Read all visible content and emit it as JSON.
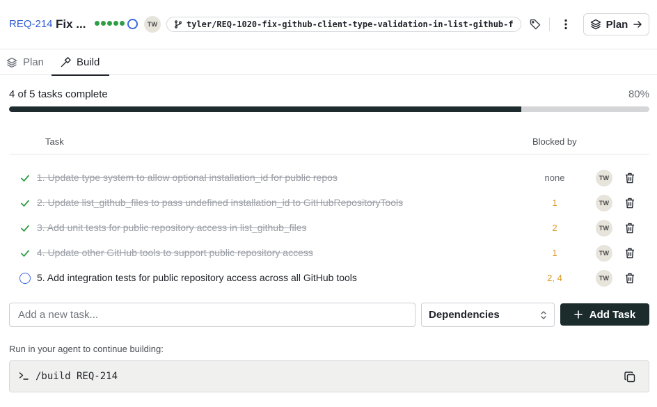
{
  "header": {
    "req_id": "REQ-214",
    "title": "Fix ...",
    "assignee_initials": "TW",
    "branch": "tyler/REQ-1020-fix-github-client-type-validation-in-list-github-f",
    "plan_button_label": "Plan",
    "accent_color": "#2f5bd3"
  },
  "tabs": [
    {
      "label": "Plan",
      "icon": "layers-icon",
      "active": false
    },
    {
      "label": "Build",
      "icon": "hammer-icon",
      "active": true
    }
  ],
  "progress": {
    "label": "4 of 5 tasks complete",
    "percent_label": "80%",
    "fraction": 0.8
  },
  "table": {
    "columns": {
      "task": "Task",
      "blocked_by": "Blocked by"
    },
    "rows": [
      {
        "status": "done",
        "text": "1. Update type system to allow optional installation_id for public repos",
        "blocked_by": "none",
        "assignee": "TW"
      },
      {
        "status": "done",
        "text": "2. Update list_github_files to pass undefined installation_id to GitHubRepositoryTools",
        "blocked_by": "1",
        "assignee": "TW"
      },
      {
        "status": "done",
        "text": "3. Add unit tests for public repository access in list_github_files",
        "blocked_by": "2",
        "assignee": "TW"
      },
      {
        "status": "done",
        "text": "4. Update other GitHub tools to support public repository access",
        "blocked_by": "1",
        "assignee": "TW"
      },
      {
        "status": "open",
        "text": "5. Add integration tests for public repository access across all GitHub tools",
        "blocked_by": "2, 4",
        "assignee": "TW"
      }
    ]
  },
  "add_task": {
    "placeholder": "Add a new task...",
    "dependencies_label": "Dependencies",
    "button_label": "Add Task"
  },
  "command": {
    "hint": "Run in your agent to continue building:",
    "text": "/build REQ-214"
  }
}
